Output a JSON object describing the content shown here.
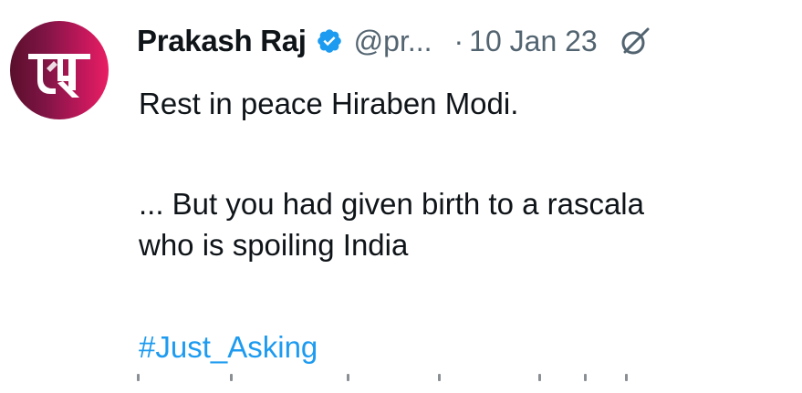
{
  "tweet": {
    "author": {
      "name": "Prakash Raj",
      "handle": "@pr...",
      "avatar_icon": "brand-logo-icon",
      "verified_icon": "verified-badge-icon",
      "verified_color": "#1d9bf0"
    },
    "separator": "·",
    "date": "10 Jan 23",
    "grok_icon": "grok-icon",
    "lines": {
      "line1": "Rest in peace Hiraben Modi.",
      "line2": "... But you had given birth to a rascala",
      "line3": "who is spoiling India"
    },
    "hashtag": "#Just_Asking",
    "colors": {
      "text": "#0f1419",
      "secondary": "#536471",
      "link": "#1d9bf0",
      "avatar_accent": "#c2185b"
    }
  }
}
